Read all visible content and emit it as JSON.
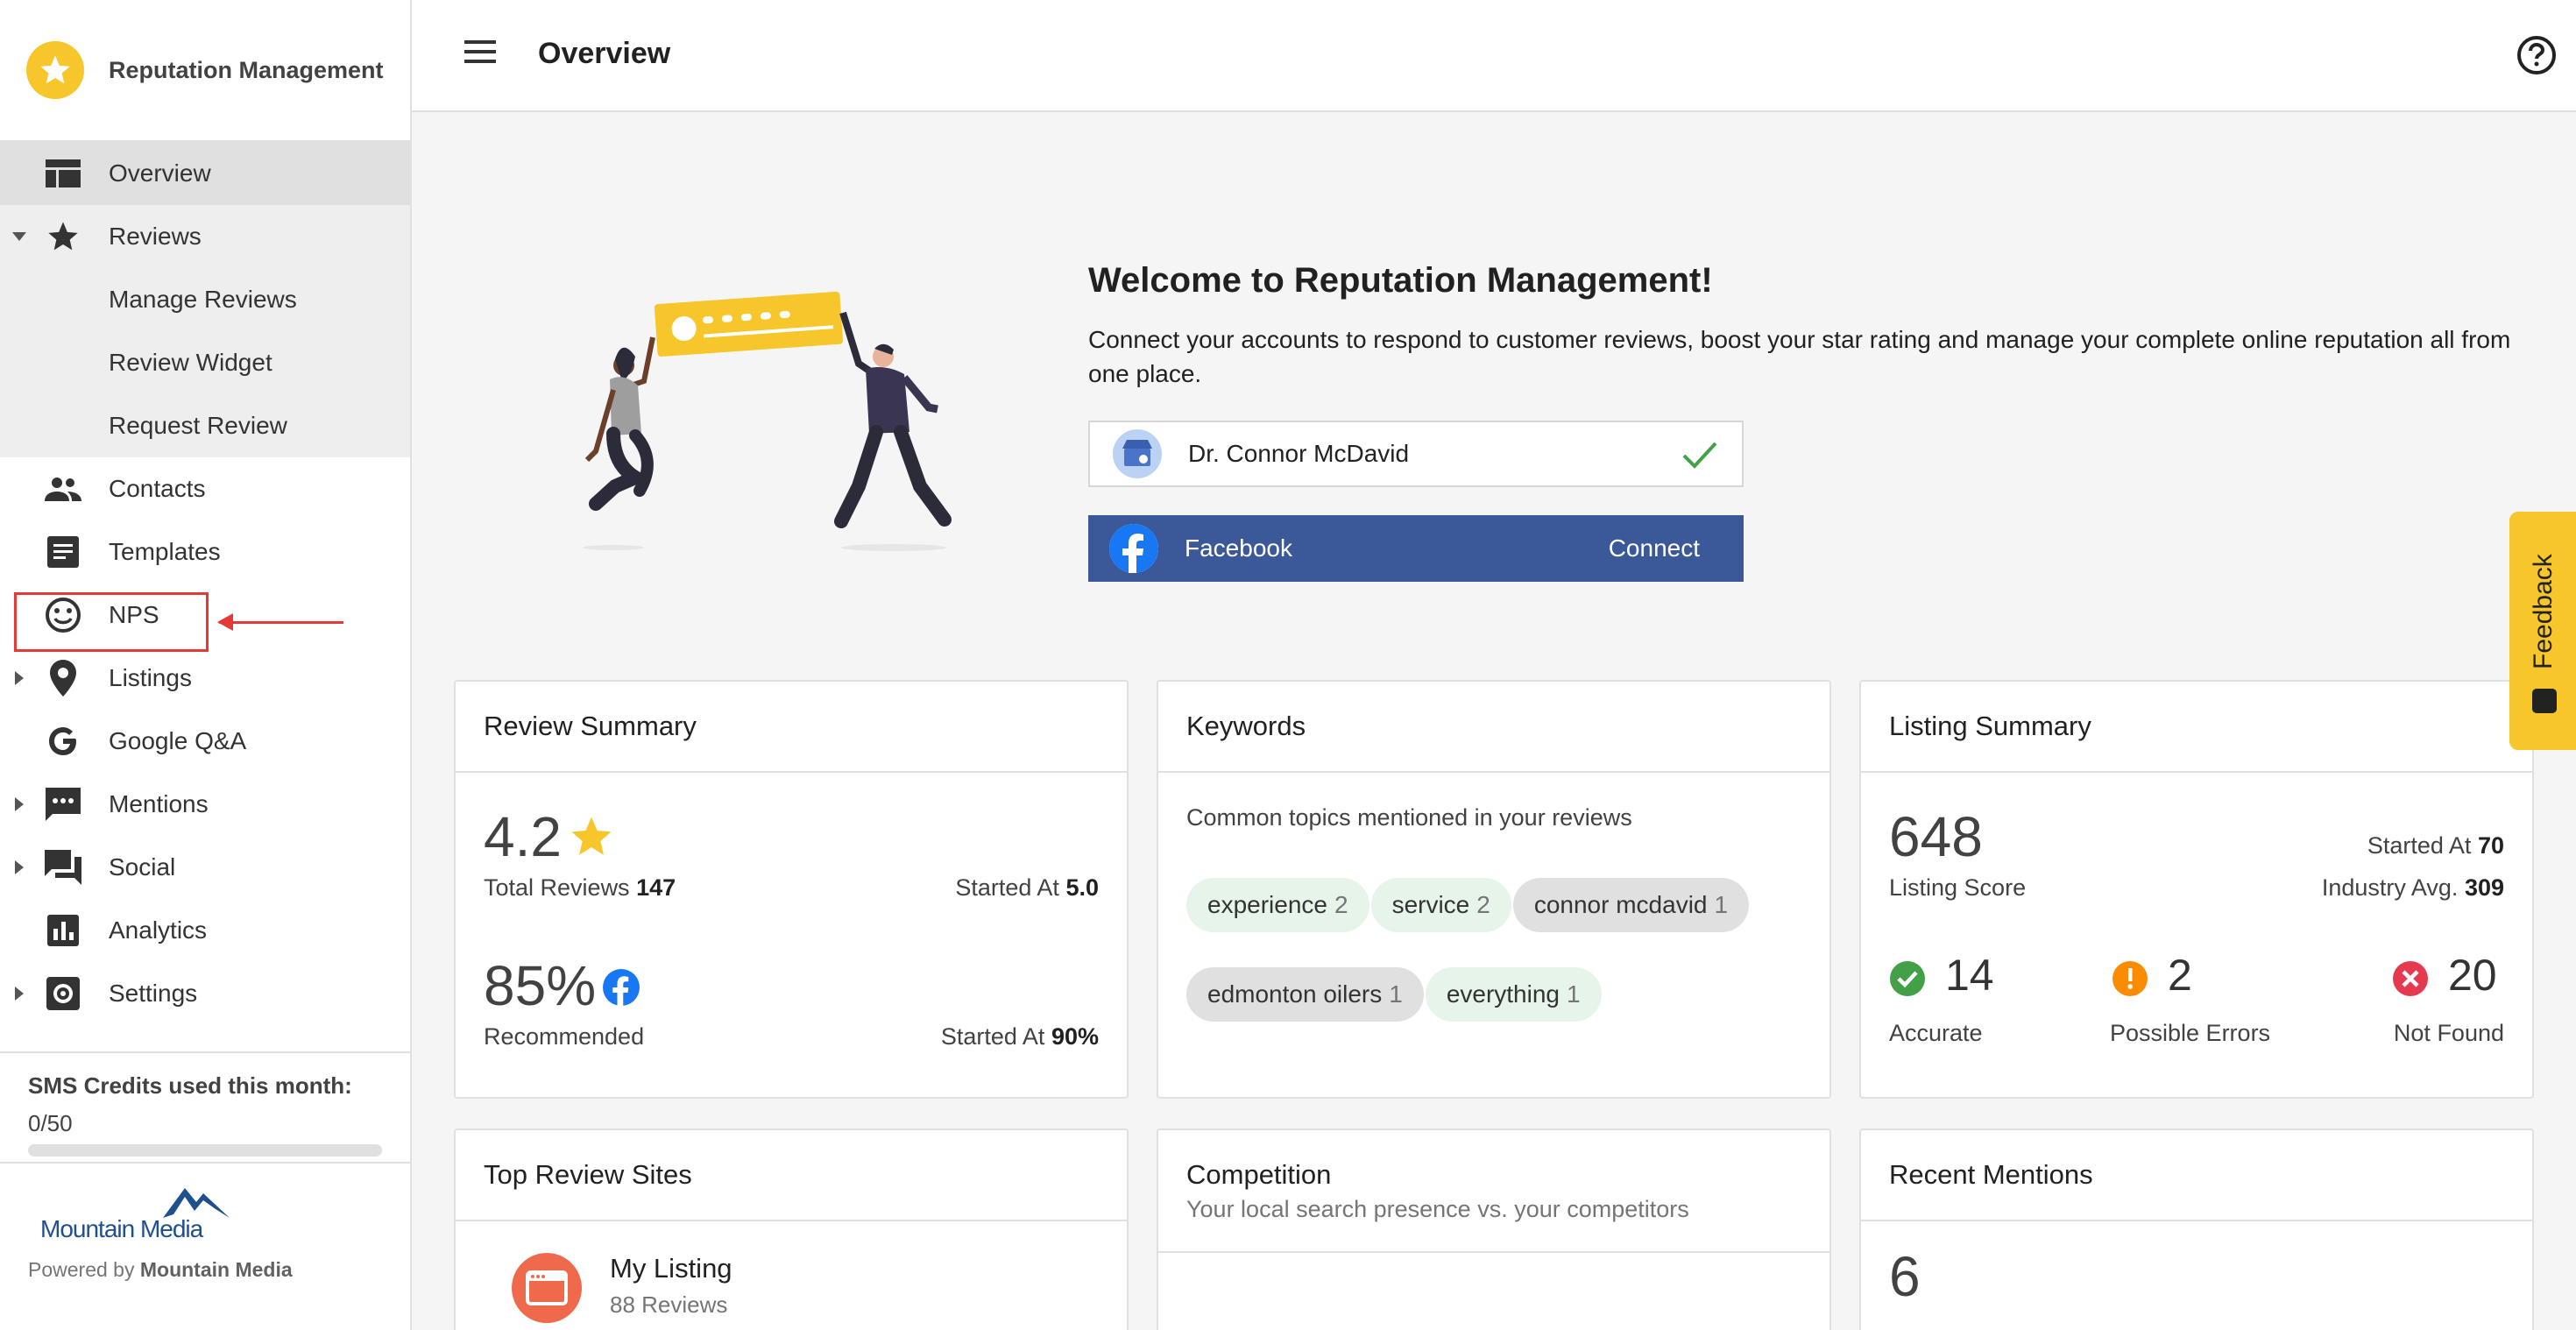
{
  "brand": {
    "title": "Reputation Management"
  },
  "sidebar": {
    "items": [
      {
        "label": "Overview",
        "icon": "dashboard-icon"
      },
      {
        "label": "Reviews",
        "icon": "star-icon"
      },
      {
        "label": "Manage Reviews"
      },
      {
        "label": "Review Widget"
      },
      {
        "label": "Request Review"
      },
      {
        "label": "Contacts",
        "icon": "people-icon"
      },
      {
        "label": "Templates",
        "icon": "document-icon"
      },
      {
        "label": "NPS",
        "icon": "smiley-icon"
      },
      {
        "label": "Listings",
        "icon": "location-pin-icon"
      },
      {
        "label": "Google Q&A",
        "icon": "google-icon"
      },
      {
        "label": "Mentions",
        "icon": "chat-icon"
      },
      {
        "label": "Social",
        "icon": "forum-icon"
      },
      {
        "label": "Analytics",
        "icon": "bar-chart-icon"
      },
      {
        "label": "Settings",
        "icon": "gear-icon"
      }
    ],
    "sms": {
      "title": "SMS Credits used this month:",
      "value": "0/50",
      "used_fraction": 0
    },
    "footer_brand": "Mountain Media",
    "powered_prefix": "Powered by",
    "powered_by": "Mountain Media"
  },
  "header": {
    "title": "Overview"
  },
  "welcome": {
    "title": "Welcome to Reputation Management!",
    "text": "Connect your accounts to respond to customer reviews, boost your star rating and manage your complete online reputation all from one place.",
    "google_account": "Dr. Connor McDavid",
    "facebook_label": "Facebook",
    "facebook_action": "Connect"
  },
  "review_summary": {
    "title": "Review Summary",
    "rating": "4.2",
    "total_label": "Total Reviews",
    "total": "147",
    "started_label": "Started At",
    "started": "5.0",
    "recommended_pct": "85%",
    "recommended_label": "Recommended",
    "rec_started_label": "Started At",
    "rec_started": "90%"
  },
  "keywords": {
    "title": "Keywords",
    "subtitle": "Common topics mentioned in your reviews",
    "chips": [
      {
        "word": "experience",
        "count": "2",
        "tone": "green"
      },
      {
        "word": "service",
        "count": "2",
        "tone": "green"
      },
      {
        "word": "connor mcdavid",
        "count": "1",
        "tone": "grey"
      },
      {
        "word": "edmonton oilers",
        "count": "1",
        "tone": "grey"
      },
      {
        "word": "everything",
        "count": "1",
        "tone": "green"
      }
    ]
  },
  "listing_summary": {
    "title": "Listing Summary",
    "score": "648",
    "score_label": "Listing Score",
    "started_label": "Started At",
    "started": "70",
    "industry_label": "Industry Avg.",
    "industry": "309",
    "accurate": "14",
    "accurate_label": "Accurate",
    "errors": "2",
    "errors_label": "Possible Errors",
    "not_found": "20",
    "not_found_label": "Not Found"
  },
  "top_sites": {
    "title": "Top Review Sites",
    "site_name": "My Listing",
    "site_reviews": "88 Reviews"
  },
  "competition": {
    "title": "Competition",
    "subtitle": "Your local search presence vs. your competitors"
  },
  "recent_mentions": {
    "title": "Recent Mentions",
    "count": "6"
  },
  "feedback": {
    "label": "Feedback"
  },
  "colors": {
    "accent": "#f6c62a",
    "facebook": "#3b5998",
    "success": "#43a047",
    "warning": "#fb8c00",
    "error": "#e53950",
    "annotation": "#e53935"
  }
}
